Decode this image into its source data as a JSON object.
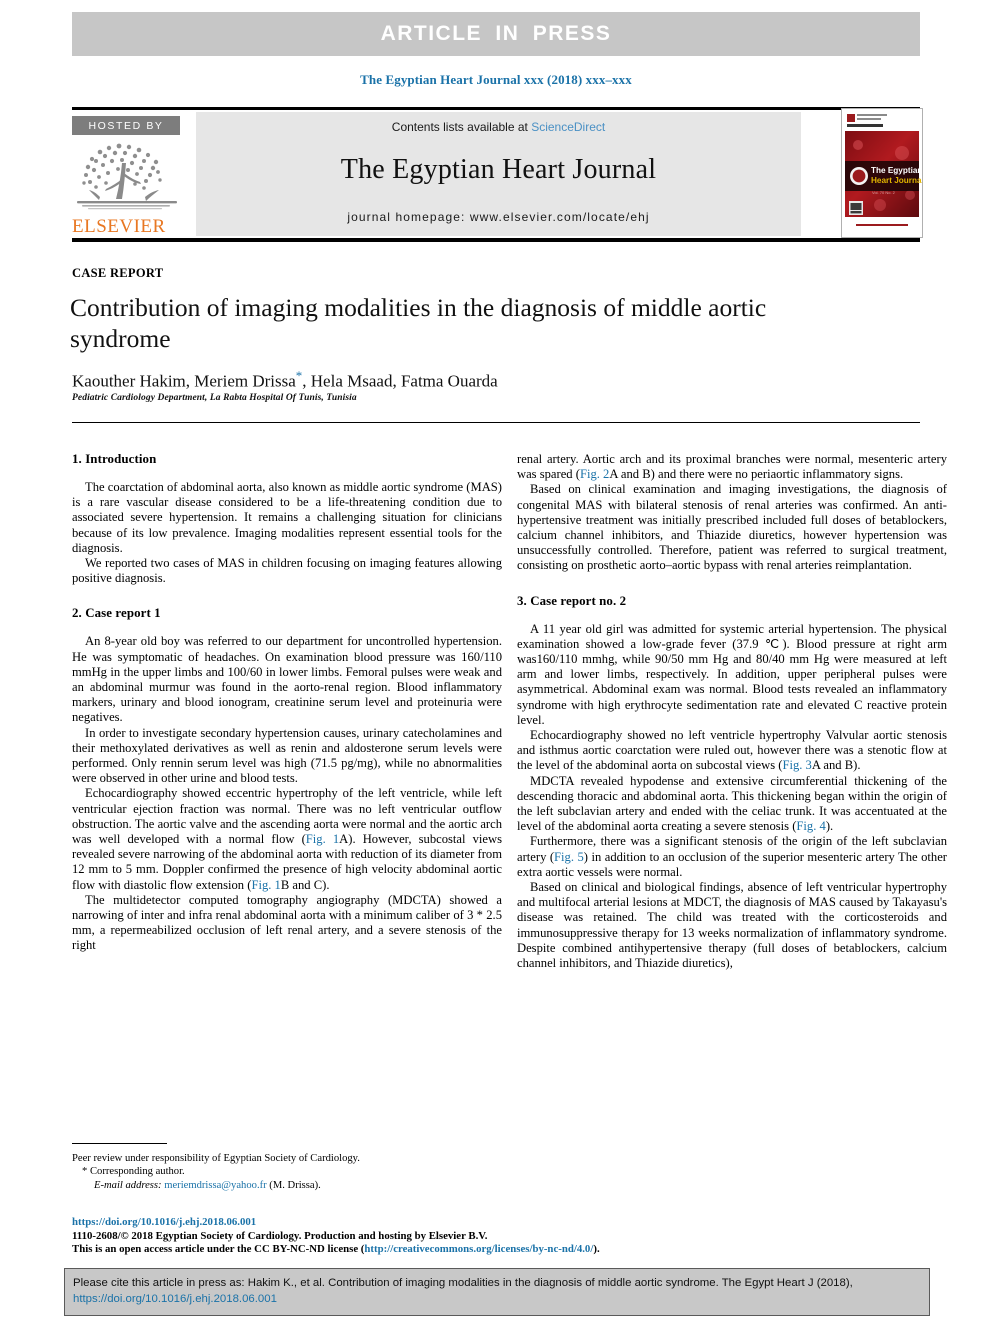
{
  "banner": {
    "text": "ARTICLE  IN  PRESS"
  },
  "running_head": "The Egyptian Heart Journal xxx (2018) xxx–xxx",
  "masthead": {
    "hosted_by": "HOSTED BY",
    "publisher": "ELSEVIER",
    "contents_prefix": "Contents lists available at ",
    "contents_link": "ScienceDirect",
    "journal_title": "The Egyptian Heart Journal",
    "homepage": "journal homepage: www.elsevier.com/locate/ehj",
    "cover_title_line1": "The Egyptian",
    "cover_title_line2": "Heart Journal"
  },
  "article": {
    "kicker": "CASE REPORT",
    "title": "Contribution of imaging modalities in the diagnosis of middle aortic syndrome",
    "authors": "Kaouther Hakim, Meriem Drissa",
    "authors_tail": ", Hela Msaad, Fatma Ouarda",
    "corresponding_marker": "*",
    "affiliation": "Pediatric Cardiology Department, La Rabta Hospital Of Tunis, Tunisia"
  },
  "left_column": {
    "heading_1": "1. Introduction",
    "p1": "The coarctation of abdominal aorta, also known as middle aortic syndrome (MAS) is a rare vascular disease considered to be a life-threatening condition due to associated severe hypertension. It remains a challenging situation for clinicians because of its low prevalence. Imaging modalities represent essential tools for the diagnosis.",
    "p2": "We reported two cases of MAS in children focusing on imaging features allowing positive diagnosis.",
    "heading_2": "2. Case report 1",
    "p3": "An 8-year old boy was referred to our department for uncontrolled hypertension. He was symptomatic of headaches. On examination blood pressure was 160/110 mmHg in the upper limbs and 100/60 in lower limbs. Femoral pulses were weak and an abdominal murmur was found in the aorto-renal region. Blood inflammatory markers, urinary and blood ionogram, creatinine serum level and proteinuria were negatives.",
    "p4": "In order to investigate secondary hypertension causes, urinary catecholamines and their methoxylated derivatives as well as renin and aldosterone serum levels were performed. Only rennin serum level was high (71.5 pg/mg), while no abnormalities were observed in other urine and blood tests.",
    "p5_a": "Echocardiography showed eccentric hypertrophy of the left ventricle, while left ventricular ejection fraction was normal. There was no left ventricular outflow obstruction. The aortic valve and the ascending aorta were normal and the aortic arch was well developed with a normal flow (",
    "p5_fig1a": "Fig. 1",
    "p5_b": "A). However, subcostal views revealed severe narrowing of the abdominal aorta with reduction of its diameter from 12 mm to 5 mm. Doppler confirmed the presence of high velocity abdominal aortic flow with diastolic flow extension (",
    "p5_fig1b": "Fig. 1",
    "p5_c": "B and C).",
    "p6": "The multidetector computed tomography angiography (MDCTA) showed a narrowing of inter and infra renal abdominal aorta with a minimum caliber of 3 * 2.5 mm, a repermeabilized occlusion of left renal artery, and a severe stenosis of the right"
  },
  "right_column": {
    "p1_a": "renal artery. Aortic arch and its proximal branches were normal, mesenteric artery was spared (",
    "p1_fig2": "Fig. 2",
    "p1_b": "A and B) and there were no periaortic inflammatory signs.",
    "p2": "Based on clinical examination and imaging investigations, the diagnosis of congenital MAS with bilateral stenosis of renal arteries was confirmed. An anti-hypertensive treatment was initially prescribed included full doses of betablockers, calcium channel inhibitors, and Thiazide diuretics, however hypertension was unsuccessfully controlled. Therefore, patient was referred to surgical treatment, consisting on prosthetic aorto–aortic bypass with renal arteries reimplantation.",
    "heading_3": "3. Case report no. 2",
    "p3": "A 11 year old girl was admitted for systemic arterial hypertension. The physical examination showed a low-grade fever (37.9 ℃). Blood pressure at right arm was160/110 mmhg, while 90/50 mm Hg and 80/40 mm Hg were measured at left arm and lower limbs, respectively. In addition, upper peripheral pulses were asymmetrical. Abdominal exam was normal. Blood tests revealed an inflammatory syndrome with high erythrocyte sedimentation rate and elevated C reactive protein level.",
    "p4_a": "Echocardiography showed no left ventricle hypertrophy Valvular aortic stenosis and isthmus aortic coarctation were ruled out, however there was a stenotic flow at the level of the abdominal aorta on subcostal views (",
    "p4_fig3": "Fig. 3",
    "p4_b": "A and B).",
    "p5_a": "MDCTA revealed hypodense and extensive circumferential thickening of the descending thoracic and abdominal aorta. This thickening began within the origin of the left subclavian artery and ended with the celiac trunk. It was accentuated at the level of the abdominal aorta creating a severe stenosis (",
    "p5_fig4": "Fig. 4",
    "p5_b": ").",
    "p6_a": "Furthermore, there was a significant stenosis of the origin of the left subclavian artery (",
    "p6_fig5": "Fig. 5",
    "p6_b": ") in addition to an occlusion of the superior mesenteric artery The other extra aortic vessels were normal.",
    "p7": "Based on clinical and biological findings, absence of left ventricular hypertrophy and multifocal arterial lesions at MDCT, the diagnosis of MAS caused by Takayasu's disease was retained. The child was treated with the corticosteroids and immunosuppressive therapy for 13 weeks normalization of inflammatory syndrome. Despite combined antihypertensive therapy (full doses of betablockers, calcium channel inhibitors, and Thiazide diuretics),"
  },
  "footnotes": {
    "peer_review": "Peer review under responsibility of Egyptian Society of Cardiology.",
    "corresponding": "Corresponding author.",
    "corresponding_star": "*",
    "email_label": "E-mail address:",
    "email": "meriemdrissa@yahoo.fr",
    "email_tail": " (M. Drissa)."
  },
  "imprint": {
    "doi": "https://doi.org/10.1016/j.ehj.2018.06.001",
    "line2": "1110-2608/© 2018 Egyptian Society of Cardiology. Production and hosting by Elsevier B.V.",
    "line3_a": "This is an open access article under the CC BY-NC-ND license (",
    "line3_link": "http://creativecommons.org/licenses/by-nc-nd/4.0/",
    "line3_b": ")."
  },
  "cite_box": {
    "line1": "Please cite this article in press as: Hakim K., et al. Contribution of imaging modalities in the diagnosis of middle aortic syndrome. The Egypt Heart J (2018),",
    "line2": "https://doi.org/10.1016/j.ehj.2018.06.001"
  },
  "colors": {
    "link_blue": "#1a72a8",
    "banner_gray": "#c6c6c6",
    "masthead_gray": "#e6e6e6",
    "elsevier_orange": "#e87722",
    "cite_gray": "#c8c8c8"
  }
}
